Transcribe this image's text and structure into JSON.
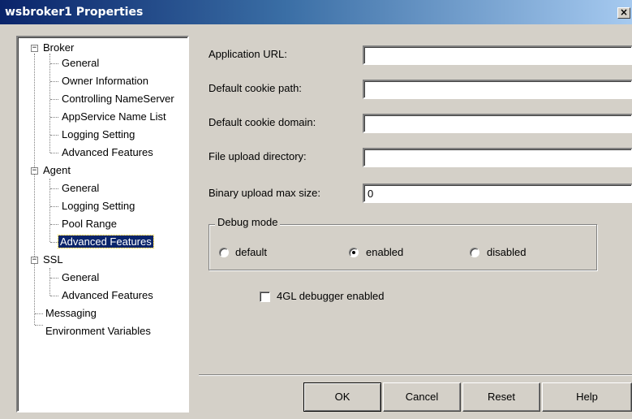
{
  "window": {
    "title": "wsbroker1 Properties",
    "close_glyph": "×"
  },
  "tree": {
    "items": [
      {
        "label": "Broker",
        "expander": "−"
      },
      {
        "label": "General"
      },
      {
        "label": "Owner Information"
      },
      {
        "label": "Controlling NameServer"
      },
      {
        "label": "AppService Name List"
      },
      {
        "label": "Logging Setting"
      },
      {
        "label": "Advanced Features"
      },
      {
        "label": "Agent",
        "expander": "−"
      },
      {
        "label": "General"
      },
      {
        "label": "Logging Setting"
      },
      {
        "label": "Pool Range"
      },
      {
        "label": "Advanced Features",
        "selected": true
      },
      {
        "label": "SSL",
        "expander": "−"
      },
      {
        "label": "General"
      },
      {
        "label": "Advanced Features"
      },
      {
        "label": "Messaging"
      },
      {
        "label": "Environment Variables"
      }
    ]
  },
  "form": {
    "application_url": {
      "label": "Application URL:",
      "value": ""
    },
    "default_cookie_path": {
      "label": "Default cookie path:",
      "value": ""
    },
    "default_cookie_domain": {
      "label": "Default cookie domain:",
      "value": ""
    },
    "file_upload_directory": {
      "label": "File upload directory:",
      "value": ""
    },
    "binary_upload_max_size": {
      "label": "Binary upload max size:",
      "value": "0"
    },
    "debug_mode": {
      "legend": "Debug mode",
      "options": [
        "default",
        "enabled",
        "disabled"
      ],
      "selected": "enabled"
    },
    "debugger_4gl": {
      "label": "4GL debugger enabled",
      "checked": false
    }
  },
  "buttons": {
    "ok": "OK",
    "cancel": "Cancel",
    "reset": "Reset",
    "help": "Help"
  },
  "colors": {
    "titlebar_start": "#0a246a",
    "titlebar_end": "#a6caf0",
    "dialog_bg": "#d4d0c8",
    "selection_bg": "#0a246a"
  }
}
